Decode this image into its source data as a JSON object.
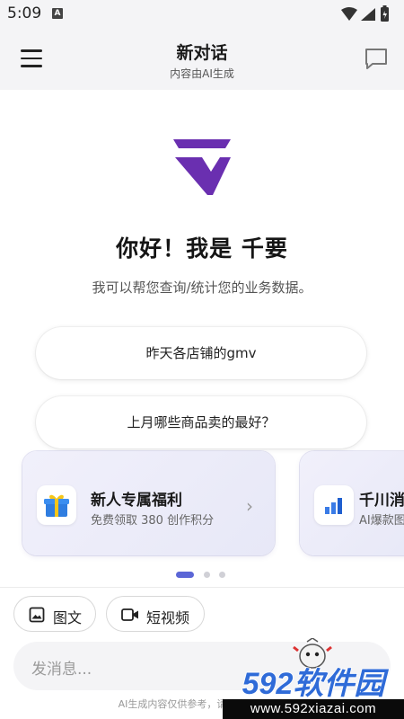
{
  "status_bar": {
    "time": "5:09",
    "notification_icon": "A"
  },
  "header": {
    "title": "新对话",
    "subtitle": "内容由AI生成"
  },
  "main": {
    "greeting": "你好！我是 千要",
    "intro": "我可以帮您查询/统计您的业务数据。",
    "suggestions": [
      "昨天各店铺的gmv",
      "上月哪些商品卖的最好？"
    ]
  },
  "cards": [
    {
      "title": "新人专属福利",
      "desc": "免费领取 380 创作积分",
      "icon": "gift-icon"
    },
    {
      "title": "千川消",
      "desc": "AI爆款图",
      "icon": "bar-chart-icon"
    }
  ],
  "carousel": {
    "pages": 3,
    "active": 0
  },
  "toolbar": {
    "image_text_label": "图文",
    "short_video_label": "短视频"
  },
  "composer": {
    "placeholder": "发消息..."
  },
  "disclaimer": "AI生成内容仅供参考，请核实重要信息",
  "watermark": {
    "logo_text": "592软件园",
    "url": "www.592xiazai.com"
  },
  "colors": {
    "brand_purple": "#6a2fb0",
    "accent_blue": "#5b66d6",
    "watermark_blue": "#2f6bd8"
  }
}
